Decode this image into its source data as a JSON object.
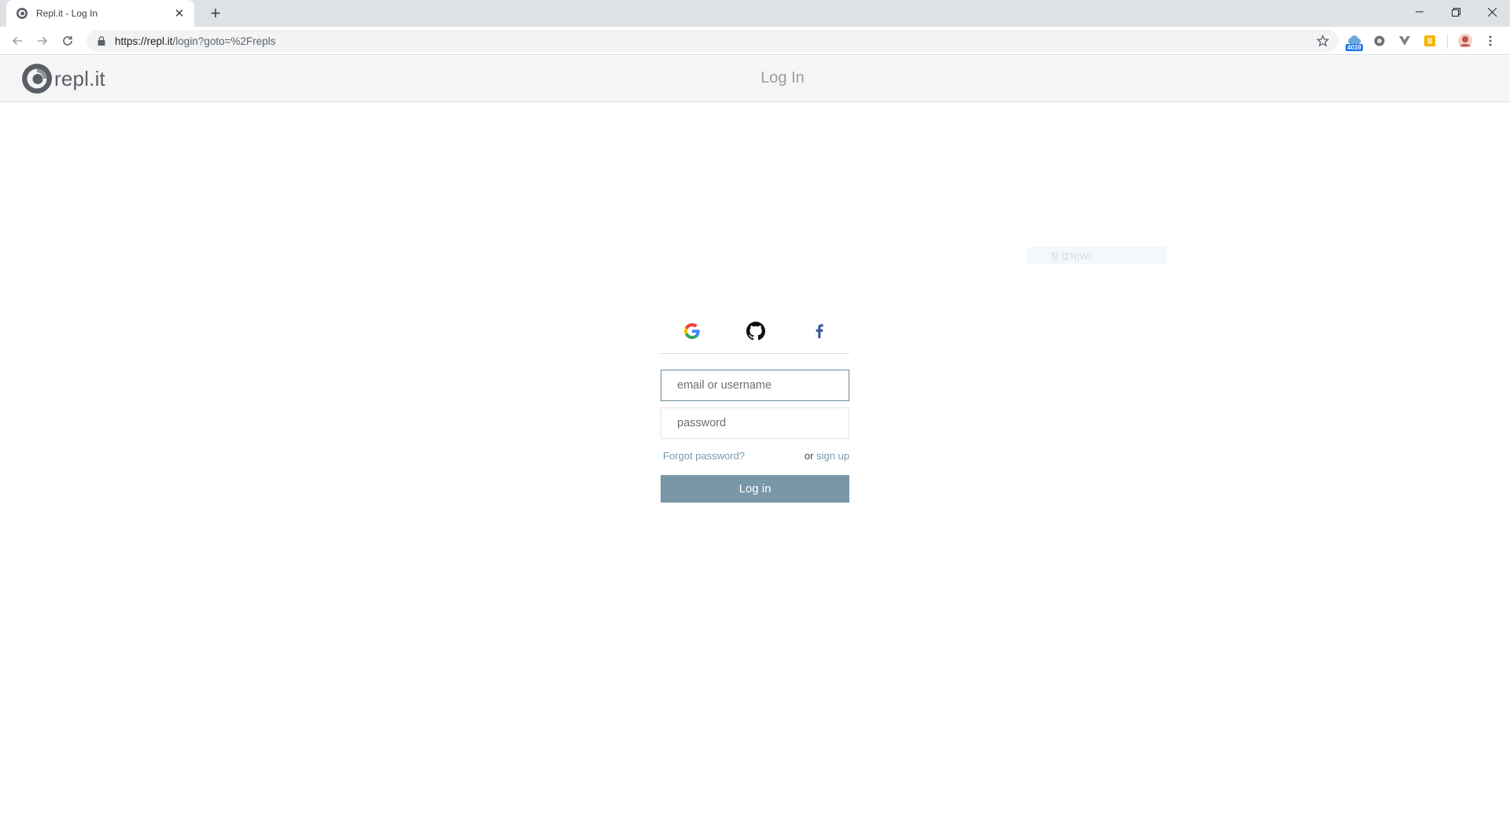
{
  "browser": {
    "tab_title": "Repl.it - Log In",
    "url_host": "https://repl.it",
    "url_path": "/login?goto=%2Frepls",
    "extension_badge": "4039"
  },
  "header": {
    "logo_text": "repl.it",
    "title": "Log In"
  },
  "context_hint": "창 캡처(W)",
  "login": {
    "email_placeholder": "email or username",
    "password_placeholder": "password",
    "forgot_label": "Forgot password?",
    "or_label": "or",
    "signup_label": "sign up",
    "submit_label": "Log in"
  },
  "colors": {
    "accent": "#7a97a8",
    "link": "#7a9aae",
    "header_bg": "#f5f5f5"
  }
}
